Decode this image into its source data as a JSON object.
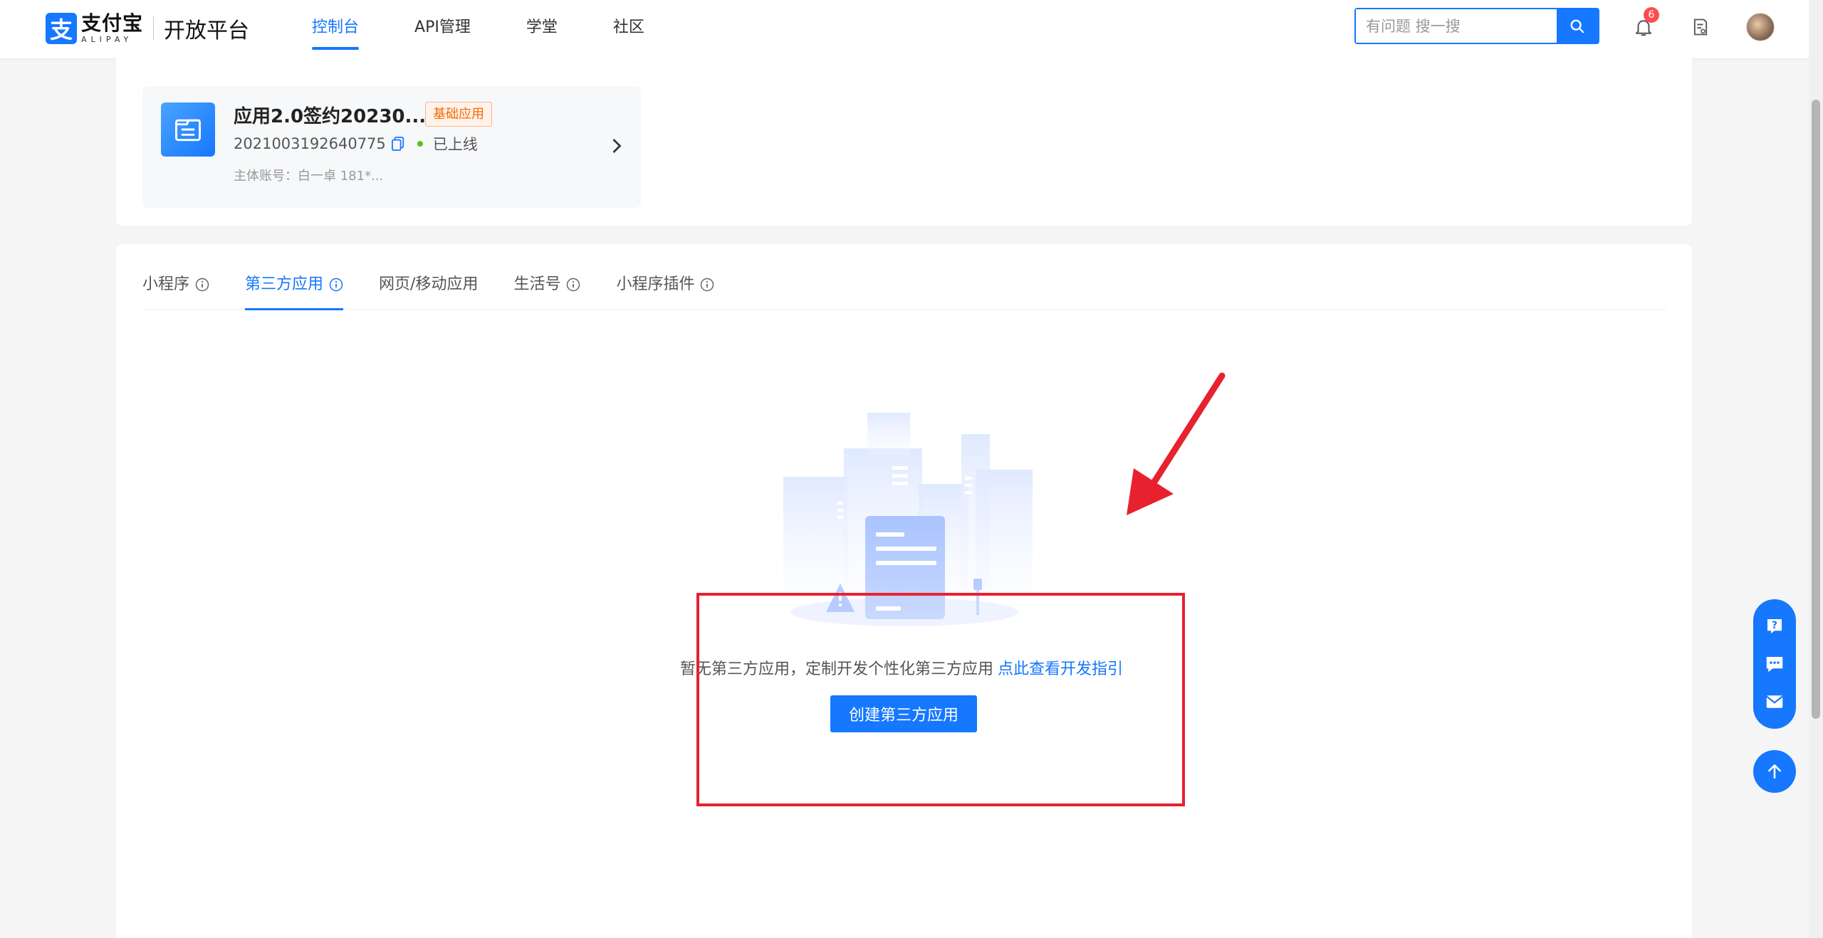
{
  "header": {
    "logo_cn": "支付宝",
    "logo_en": "ALIPAY",
    "logo_sub": "开放平台",
    "nav": [
      {
        "label": "控制台",
        "active": true
      },
      {
        "label": "API管理"
      },
      {
        "label": "学堂"
      },
      {
        "label": "社区"
      }
    ],
    "search_placeholder": "有问题 搜一搜",
    "notification_count": "6"
  },
  "app_card": {
    "name": "应用2.0签约20230...",
    "tag": "基础应用",
    "app_id": "2021003192640775",
    "status": "已上线",
    "owner": "主体账号：白一卓  181*..."
  },
  "tabs": [
    {
      "label": "小程序",
      "info": true
    },
    {
      "label": "第三方应用",
      "info": true,
      "active": true
    },
    {
      "label": "网页/移动应用",
      "info": false
    },
    {
      "label": "生活号",
      "info": true
    },
    {
      "label": "小程序插件",
      "info": true
    }
  ],
  "empty": {
    "text": "暂无第三方应用，定制开发个性化第三方应用",
    "link": "点此查看开发指引",
    "button": "创建第三方应用"
  },
  "colors": {
    "primary": "#1677ff",
    "annotation_red": "#e8212f",
    "tag_orange": "#f56a00",
    "status_green": "#52c41a"
  }
}
